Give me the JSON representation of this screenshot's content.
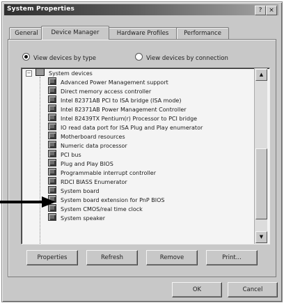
{
  "window": {
    "title": "System Properties",
    "controls": [
      "?",
      "×"
    ]
  },
  "tabs": [
    {
      "label": "General",
      "active": false
    },
    {
      "label": "Device Manager",
      "active": true
    },
    {
      "label": "Hardware Profiles",
      "active": false
    },
    {
      "label": "Performance",
      "active": false
    }
  ],
  "view_options": {
    "by_type": {
      "label": "View devices by type",
      "selected": true
    },
    "by_connection": {
      "label": "View devices by connection",
      "selected": false
    }
  },
  "tree": {
    "category": {
      "label": "System devices",
      "expander": "−"
    },
    "items": [
      "Advanced Power Management support",
      "Direct memory access controller",
      "Intel 82371AB PCI to ISA bridge (ISA mode)",
      "Intel 82371AB Power Management Controller",
      "Intel 82439TX Pentium(r) Processor to PCI bridge",
      "IO read data port for ISA Plug and Play enumerator",
      "Motherboard resources",
      "Numeric data processor",
      "PCI bus",
      "Plug and Play BIOS",
      "Programmable interrupt controller",
      "RDCI BIASS Enumerator",
      "System board",
      "System board extension for PnP BIOS",
      "System CMOS/real time clock",
      "System speaker"
    ]
  },
  "scrollbar": {
    "up_glyph": "▲",
    "down_glyph": "▼"
  },
  "panel_buttons": {
    "properties": "Properties",
    "refresh": "Refresh",
    "remove": "Remove",
    "print": "Print..."
  },
  "dialog_buttons": {
    "ok": "OK",
    "cancel": "Cancel"
  },
  "colors": {
    "title_dark": "#2e2e2e",
    "face": "#c8c8c8",
    "list_bg": "#f4f4f4",
    "arrow": "#000000"
  }
}
